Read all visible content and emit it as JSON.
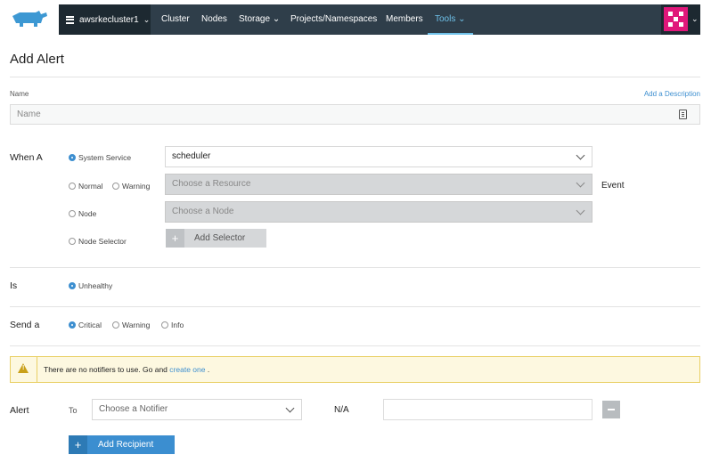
{
  "nav": {
    "cluster": "awsrkecluster1",
    "items": [
      "Cluster",
      "Nodes",
      "Storage",
      "Projects/Namespaces",
      "Members",
      "Tools"
    ],
    "active": "Tools"
  },
  "page": {
    "title": "Add Alert"
  },
  "name_field": {
    "label": "Name",
    "placeholder": "Name",
    "add_description": "Add a Description"
  },
  "when": {
    "label": "When A",
    "options": {
      "system_service": "System Service",
      "normal": "Normal",
      "warning": "Warning",
      "node": "Node",
      "node_selector": "Node Selector"
    },
    "selected": "System Service",
    "service_value": "scheduler",
    "resource_placeholder": "Choose a Resource",
    "event_label": "Event",
    "node_placeholder": "Choose a Node",
    "add_selector": "Add Selector"
  },
  "is": {
    "label": "Is",
    "option": "Unhealthy"
  },
  "send": {
    "label": "Send a",
    "options": [
      "Critical",
      "Warning",
      "Info"
    ],
    "selected": "Critical"
  },
  "notice": {
    "text": "There are no notifiers to use. Go and",
    "link": "create one",
    "tail": "."
  },
  "alert": {
    "label": "Alert",
    "to_label": "To",
    "notifier_placeholder": "Choose a Notifier",
    "na_label": "N/A",
    "add_recipient": "Add Recipient"
  },
  "colors": {
    "accent": "#3d8fd0",
    "nav_bg": "#2f3e4a",
    "avatar": "#e0177a",
    "warning_bg": "#fdf8e0"
  }
}
